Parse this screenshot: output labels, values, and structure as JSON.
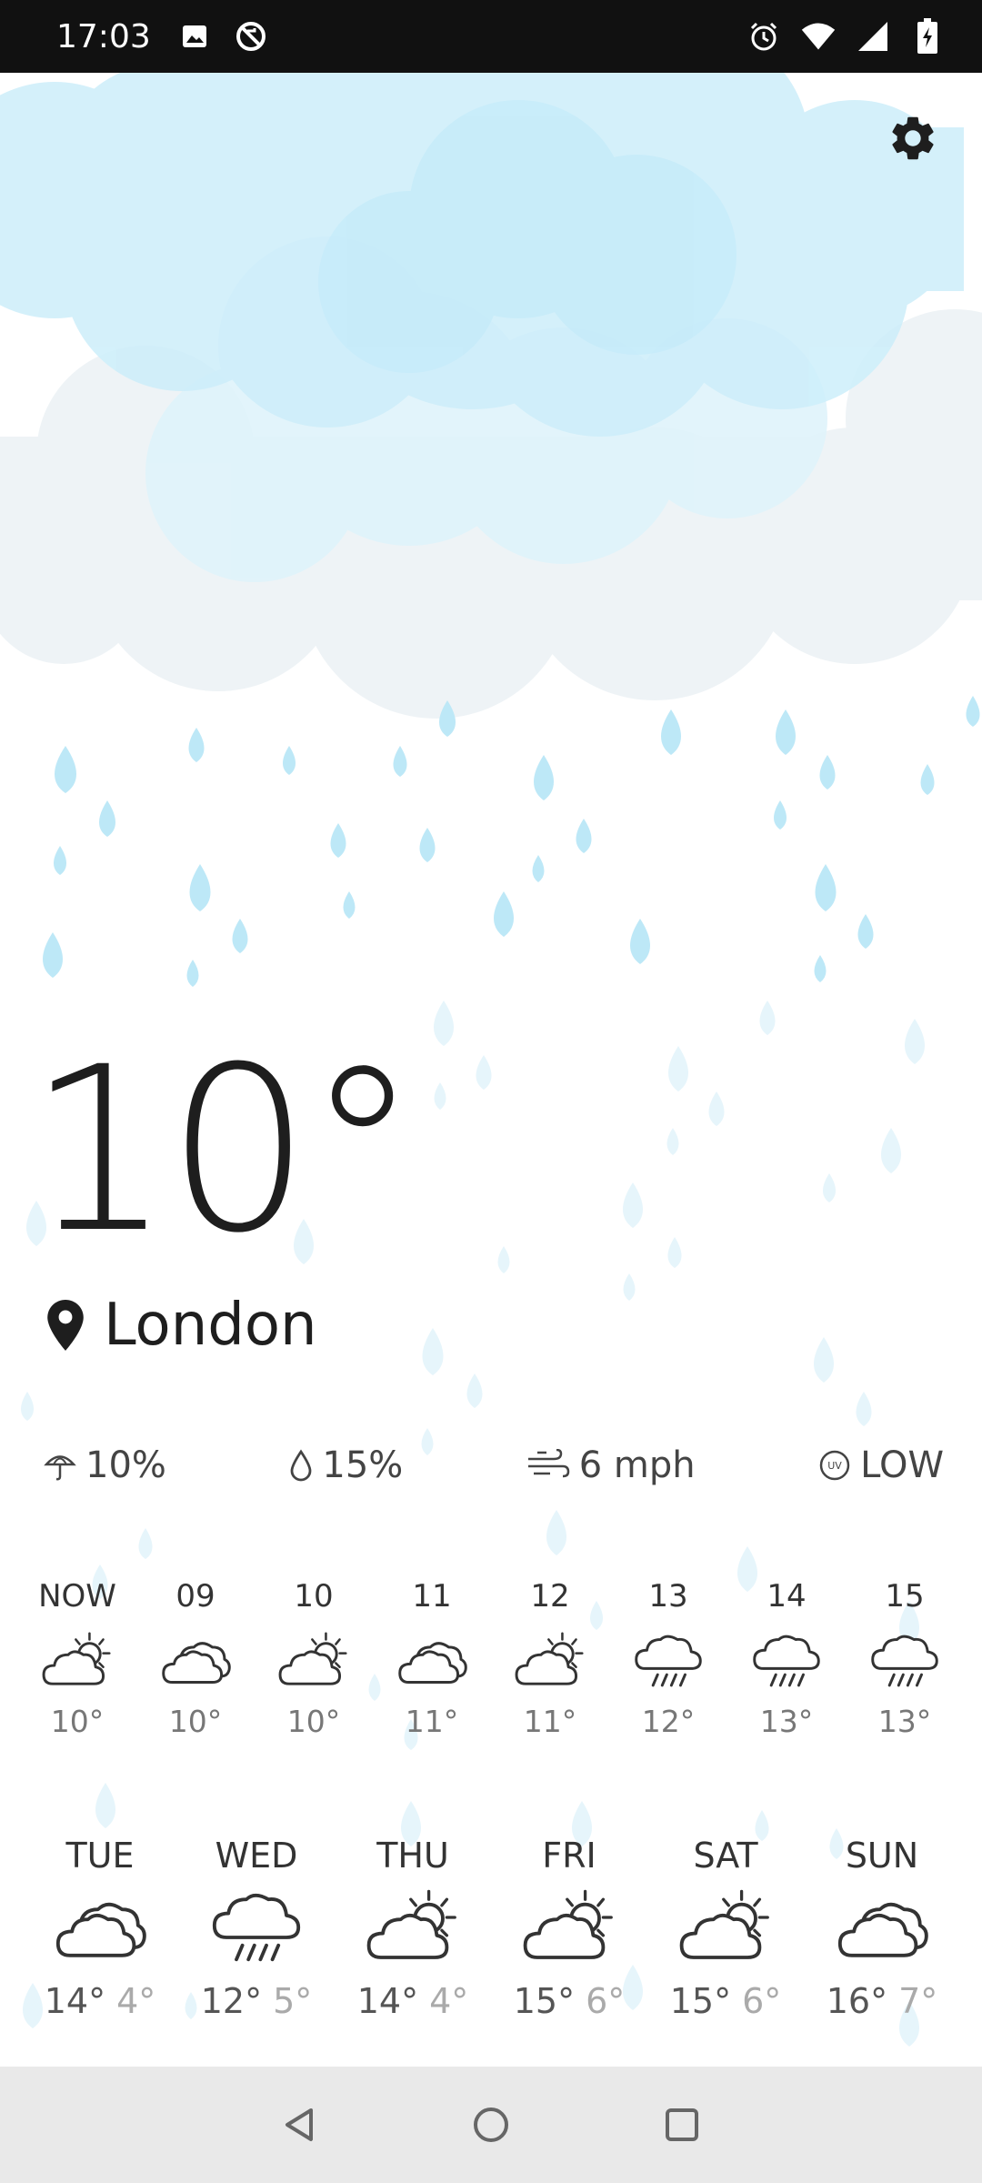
{
  "status_bar": {
    "time": "17:03",
    "left_icons": [
      "image-icon",
      "sync-off-icon"
    ],
    "right_icons": [
      "alarm-icon",
      "wifi-icon",
      "signal-icon",
      "battery-charging-icon"
    ]
  },
  "current": {
    "temperature": "10°",
    "location": "London"
  },
  "metrics": {
    "precipitation": "10%",
    "humidity": "15%",
    "wind": "6 mph",
    "uv": "LOW"
  },
  "hourly": [
    {
      "label": "NOW",
      "temp": "10°",
      "icon": "partly-sunny"
    },
    {
      "label": "09",
      "temp": "10°",
      "icon": "cloudy"
    },
    {
      "label": "10",
      "temp": "10°",
      "icon": "partly-sunny"
    },
    {
      "label": "11",
      "temp": "11°",
      "icon": "cloudy"
    },
    {
      "label": "12",
      "temp": "11°",
      "icon": "partly-sunny"
    },
    {
      "label": "13",
      "temp": "12°",
      "icon": "rain"
    },
    {
      "label": "14",
      "temp": "13°",
      "icon": "rain"
    },
    {
      "label": "15",
      "temp": "13°",
      "icon": "rain"
    }
  ],
  "daily": [
    {
      "label": "TUE",
      "high": "14°",
      "low": "4°",
      "icon": "cloudy"
    },
    {
      "label": "WED",
      "high": "12°",
      "low": "5°",
      "icon": "rain"
    },
    {
      "label": "THU",
      "high": "14°",
      "low": "4°",
      "icon": "partly-sunny"
    },
    {
      "label": "FRI",
      "high": "15°",
      "low": "6°",
      "icon": "partly-sunny"
    },
    {
      "label": "SAT",
      "high": "15°",
      "low": "6°",
      "icon": "partly-sunny"
    },
    {
      "label": "SUN",
      "high": "16°",
      "low": "7°",
      "icon": "cloudy"
    }
  ],
  "colors": {
    "cloud_blue": "#cdeefa",
    "cloud_grey": "#eef3f6",
    "raindrop": "#bde8f7",
    "text_dark": "#1e1e1e",
    "nav_bar": "#e9e9e9"
  },
  "nav": [
    "back-icon",
    "home-icon",
    "recents-icon"
  ]
}
